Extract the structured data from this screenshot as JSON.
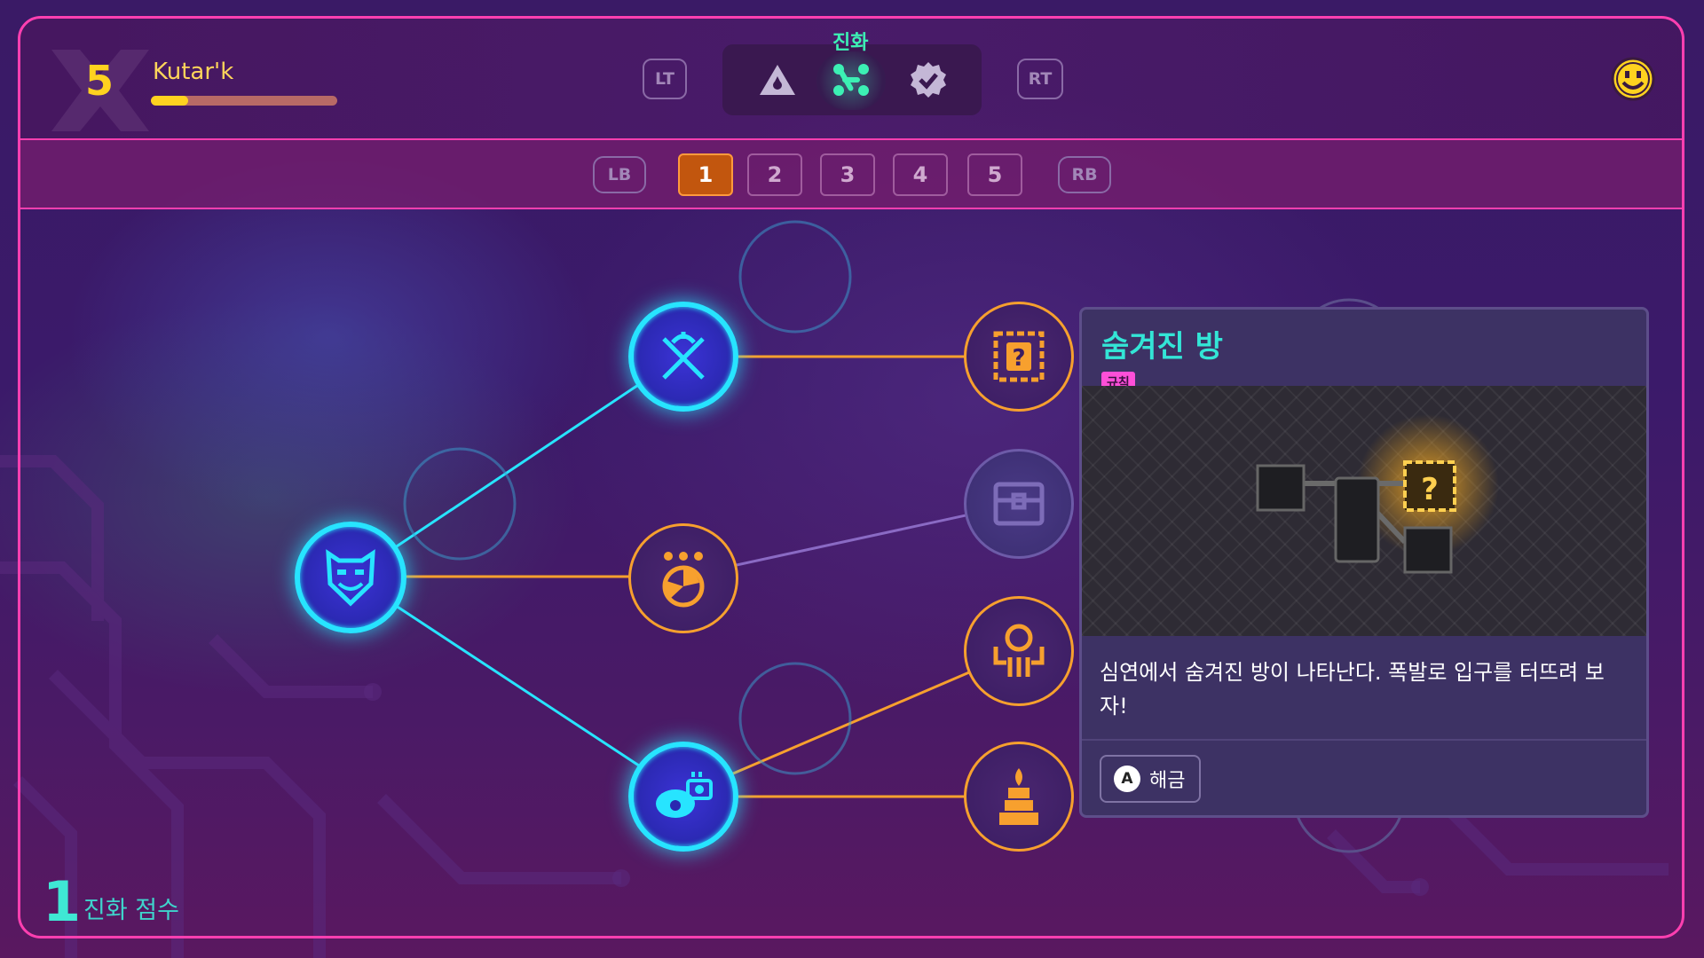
{
  "player": {
    "level": "5",
    "name": "Kutar'k",
    "xp_fraction": 0.2
  },
  "header": {
    "mode_label": "진화",
    "lt_label": "LT",
    "rt_label": "RT",
    "modes": [
      "warning-triangle-icon",
      "evolution-nodes-icon",
      "badge-check-icon"
    ]
  },
  "tabs": {
    "lb_label": "LB",
    "rb_label": "RB",
    "items": [
      "1",
      "2",
      "3",
      "4",
      "5"
    ],
    "active_index": 0
  },
  "score": {
    "value": "1",
    "label": "진화 점수"
  },
  "card": {
    "title": "숨겨진 방",
    "tag": "규칙",
    "description": "심연에서 숨겨진 방이 나타난다. 폭발로 입구를 터뜨려 보자!",
    "action_key": "A",
    "action_label": "해금"
  },
  "colors": {
    "accent": "#ff3fb0",
    "active_node": "#27e4ff",
    "available_node": "#f7a02e",
    "locked_node": "#6d5ba8",
    "active_mode": "#3cf0b4"
  },
  "nodes": [
    {
      "id": "root",
      "icon": "demon-mask-icon",
      "state": "unlocked"
    },
    {
      "id": "top",
      "icon": "crossed-swords-icon",
      "state": "unlocked"
    },
    {
      "id": "mid",
      "icon": "bomb-cluster-icon",
      "state": "available"
    },
    {
      "id": "bottom",
      "icon": "fish-camera-icon",
      "state": "unlocked"
    },
    {
      "id": "hidden-room",
      "icon": "question-block-icon",
      "state": "available"
    },
    {
      "id": "chest",
      "icon": "treasure-chest-icon",
      "state": "locked"
    },
    {
      "id": "trap",
      "icon": "claw-trap-icon",
      "state": "available"
    },
    {
      "id": "shrine",
      "icon": "fire-shrine-icon",
      "state": "available"
    }
  ]
}
